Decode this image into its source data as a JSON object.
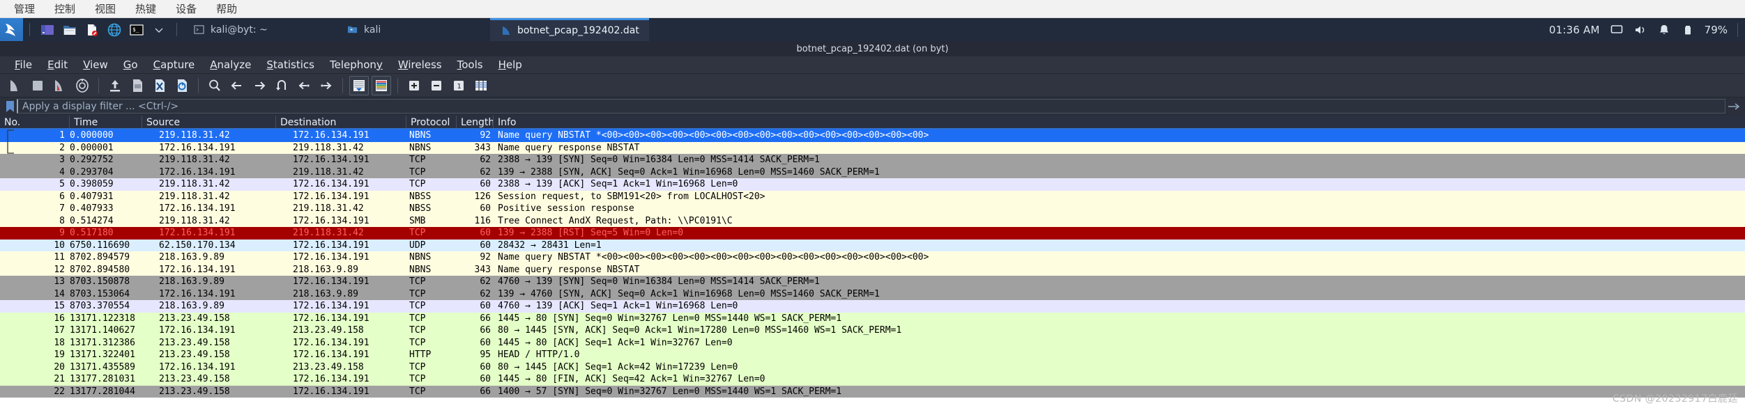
{
  "os_menubar": {
    "items": [
      {
        "label": "管理",
        "name": "os-menu-manage"
      },
      {
        "label": "控制",
        "name": "os-menu-control"
      },
      {
        "label": "视图",
        "name": "os-menu-view"
      },
      {
        "label": "热键",
        "name": "os-menu-hotkey"
      },
      {
        "label": "设备",
        "name": "os-menu-device"
      },
      {
        "label": "帮助",
        "name": "os-menu-help"
      }
    ]
  },
  "taskbar": {
    "launchers": [
      {
        "name": "kali-menu-icon",
        "label": "kali-dragon"
      },
      {
        "name": "files-purple-icon",
        "label": "app"
      },
      {
        "name": "file-manager-icon",
        "label": "file-manager"
      },
      {
        "name": "text-editor-icon",
        "label": "editor"
      },
      {
        "name": "web-browser-icon",
        "label": "browser"
      },
      {
        "name": "terminal-icon",
        "label": "terminal"
      },
      {
        "name": "chevron-down-icon",
        "label": "more"
      }
    ],
    "windows": [
      {
        "title": "kali@byt: ~",
        "icon": "terminal-icon",
        "active": false
      },
      {
        "title": "kali",
        "icon": "folder-icon",
        "active": false
      },
      {
        "title": "botnet_pcap_192402.dat",
        "icon": "wireshark-icon",
        "active": true
      }
    ],
    "clock": "01:36 AM",
    "tray": [
      "display-icon",
      "volume-icon",
      "bell-icon",
      "battery-icon"
    ],
    "battery": "79%"
  },
  "window": {
    "title": "botnet_pcap_192402.dat (on byt)"
  },
  "menubar": {
    "items": [
      {
        "label": "File",
        "mnemonic": "F"
      },
      {
        "label": "Edit",
        "mnemonic": "E"
      },
      {
        "label": "View",
        "mnemonic": "V"
      },
      {
        "label": "Go",
        "mnemonic": "G"
      },
      {
        "label": "Capture",
        "mnemonic": "C"
      },
      {
        "label": "Analyze",
        "mnemonic": "A"
      },
      {
        "label": "Statistics",
        "mnemonic": "S"
      },
      {
        "label": "Telephony",
        "mnemonic": "y"
      },
      {
        "label": "Wireless",
        "mnemonic": "W"
      },
      {
        "label": "Tools",
        "mnemonic": "T"
      },
      {
        "label": "Help",
        "mnemonic": "H"
      }
    ]
  },
  "toolbar": {
    "buttons": [
      "start-capture-icon",
      "stop-capture-icon",
      "restart-capture-icon",
      "capture-options-icon",
      "sep",
      "open-file-icon",
      "save-file-icon",
      "close-file-icon",
      "reload-file-icon",
      "sep",
      "find-packet-icon",
      "go-back-icon",
      "go-forward-icon",
      "go-to-packet-icon",
      "go-first-packet-icon",
      "go-last-packet-icon",
      "sep",
      "auto-scroll-icon",
      "colorize-icon",
      "sep",
      "zoom-in-icon",
      "zoom-out-icon",
      "zoom-reset-icon",
      "resize-columns-icon"
    ]
  },
  "filter": {
    "placeholder": "Apply a display filter ... <Ctrl-/>",
    "value": "",
    "bookmark_icon": "bookmark-icon",
    "apply_icon": "filter-apply-icon"
  },
  "packet_list": {
    "columns": [
      "No.",
      "Time",
      "Source",
      "Destination",
      "Protocol",
      "Length",
      "Info"
    ],
    "rows": [
      {
        "no": "1",
        "time": "0.000000",
        "src": "219.118.31.42",
        "dst": "172.16.134.191",
        "proto": "NBNS",
        "len": "92",
        "info": "Name query NBSTAT *<00><00><00><00><00><00><00><00><00><00><00><00><00><00><00>",
        "style": "bg-selected"
      },
      {
        "no": "2",
        "time": "0.000001",
        "src": "172.16.134.191",
        "dst": "219.118.31.42",
        "proto": "NBNS",
        "len": "343",
        "info": "Name query response NBSTAT",
        "style": "bg-nbns"
      },
      {
        "no": "3",
        "time": "0.292752",
        "src": "219.118.31.42",
        "dst": "172.16.134.191",
        "proto": "TCP",
        "len": "62",
        "info": "2388 → 139 [SYN] Seq=0 Win=16384 Len=0 MSS=1414 SACK_PERM=1",
        "style": "bg-tcp"
      },
      {
        "no": "4",
        "time": "0.293704",
        "src": "172.16.134.191",
        "dst": "219.118.31.42",
        "proto": "TCP",
        "len": "62",
        "info": "139 → 2388 [SYN, ACK] Seq=0 Ack=1 Win=16968 Len=0 MSS=1460 SACK_PERM=1",
        "style": "bg-tcp"
      },
      {
        "no": "5",
        "time": "0.398059",
        "src": "219.118.31.42",
        "dst": "172.16.134.191",
        "proto": "TCP",
        "len": "60",
        "info": "2388 → 139 [ACK] Seq=1 Ack=1 Win=16968 Len=0",
        "style": "bg-ack"
      },
      {
        "no": "6",
        "time": "0.407931",
        "src": "219.118.31.42",
        "dst": "172.16.134.191",
        "proto": "NBSS",
        "len": "126",
        "info": "Session request, to SBM191<20> from LOCALHOST<20>",
        "style": "bg-nbns"
      },
      {
        "no": "7",
        "time": "0.407933",
        "src": "172.16.134.191",
        "dst": "219.118.31.42",
        "proto": "NBSS",
        "len": "60",
        "info": "Positive session response",
        "style": "bg-nbns"
      },
      {
        "no": "8",
        "time": "0.514274",
        "src": "219.118.31.42",
        "dst": "172.16.134.191",
        "proto": "SMB",
        "len": "116",
        "info": "Tree Connect AndX Request, Path: \\\\PC0191\\C",
        "style": "bg-nbns"
      },
      {
        "no": "9",
        "time": "0.517180",
        "src": "172.16.134.191",
        "dst": "219.118.31.42",
        "proto": "TCP",
        "len": "60",
        "info": "139 → 2388 [RST] Seq=5 Win=0 Len=0",
        "style": "bg-bad"
      },
      {
        "no": "10",
        "time": "6750.116690",
        "src": "62.150.170.134",
        "dst": "172.16.134.191",
        "proto": "UDP",
        "len": "60",
        "info": "28432 → 28431 Len=1",
        "style": "bg-udp"
      },
      {
        "no": "11",
        "time": "8702.894579",
        "src": "218.163.9.89",
        "dst": "172.16.134.191",
        "proto": "NBNS",
        "len": "92",
        "info": "Name query NBSTAT *<00><00><00><00><00><00><00><00><00><00><00><00><00><00><00>",
        "style": "bg-nbns"
      },
      {
        "no": "12",
        "time": "8702.894580",
        "src": "172.16.134.191",
        "dst": "218.163.9.89",
        "proto": "NBNS",
        "len": "343",
        "info": "Name query response NBSTAT",
        "style": "bg-nbns"
      },
      {
        "no": "13",
        "time": "8703.150878",
        "src": "218.163.9.89",
        "dst": "172.16.134.191",
        "proto": "TCP",
        "len": "62",
        "info": "4760 → 139 [SYN] Seq=0 Win=16384 Len=0 MSS=1414 SACK_PERM=1",
        "style": "bg-tcp"
      },
      {
        "no": "14",
        "time": "8703.153064",
        "src": "172.16.134.191",
        "dst": "218.163.9.89",
        "proto": "TCP",
        "len": "62",
        "info": "139 → 4760 [SYN, ACK] Seq=0 Ack=1 Win=16968 Len=0 MSS=1460 SACK_PERM=1",
        "style": "bg-tcp"
      },
      {
        "no": "15",
        "time": "8703.370554",
        "src": "218.163.9.89",
        "dst": "172.16.134.191",
        "proto": "TCP",
        "len": "60",
        "info": "4760 → 139 [ACK] Seq=1 Ack=1 Win=16968 Len=0",
        "style": "bg-ack"
      },
      {
        "no": "16",
        "time": "13171.122318",
        "src": "213.23.49.158",
        "dst": "172.16.134.191",
        "proto": "TCP",
        "len": "66",
        "info": "1445 → 80 [SYN] Seq=0 Win=32767 Len=0 MSS=1440 WS=1 SACK_PERM=1",
        "style": "bg-http"
      },
      {
        "no": "17",
        "time": "13171.140627",
        "src": "172.16.134.191",
        "dst": "213.23.49.158",
        "proto": "TCP",
        "len": "66",
        "info": "80 → 1445 [SYN, ACK] Seq=0 Ack=1 Win=17280 Len=0 MSS=1460 WS=1 SACK_PERM=1",
        "style": "bg-http"
      },
      {
        "no": "18",
        "time": "13171.312386",
        "src": "213.23.49.158",
        "dst": "172.16.134.191",
        "proto": "TCP",
        "len": "60",
        "info": "1445 → 80 [ACK] Seq=1 Ack=1 Win=32767 Len=0",
        "style": "bg-http"
      },
      {
        "no": "19",
        "time": "13171.322401",
        "src": "213.23.49.158",
        "dst": "172.16.134.191",
        "proto": "HTTP",
        "len": "95",
        "info": "HEAD / HTTP/1.0",
        "style": "bg-http"
      },
      {
        "no": "20",
        "time": "13171.435589",
        "src": "172.16.134.191",
        "dst": "213.23.49.158",
        "proto": "TCP",
        "len": "60",
        "info": "80 → 1445 [ACK] Seq=1 Ack=42 Win=17239 Len=0",
        "style": "bg-http"
      },
      {
        "no": "21",
        "time": "13177.281031",
        "src": "213.23.49.158",
        "dst": "172.16.134.191",
        "proto": "TCP",
        "len": "60",
        "info": "1445 → 80 [FIN, ACK] Seq=42 Ack=1 Win=32767 Len=0",
        "style": "bg-http"
      },
      {
        "no": "22",
        "time": "13177.281044",
        "src": "213.23.49.158",
        "dst": "172.16.134.191",
        "proto": "TCP",
        "len": "66",
        "info": "1400 → 57 [SYN] Seq=0 Win=32767 Len=0 MSS=1440 WS=1 SACK_PERM=1",
        "style": "bg-tcp"
      }
    ]
  },
  "watermark": "CSDN @20232917白鹿廷",
  "colors": {
    "accent": "#1d6ef5",
    "taskbar_bg": "#222b3b",
    "ws_chrome": "#2f3440",
    "bad_packet_bg": "#a40000",
    "bad_packet_fg": "#ff5f5f"
  }
}
